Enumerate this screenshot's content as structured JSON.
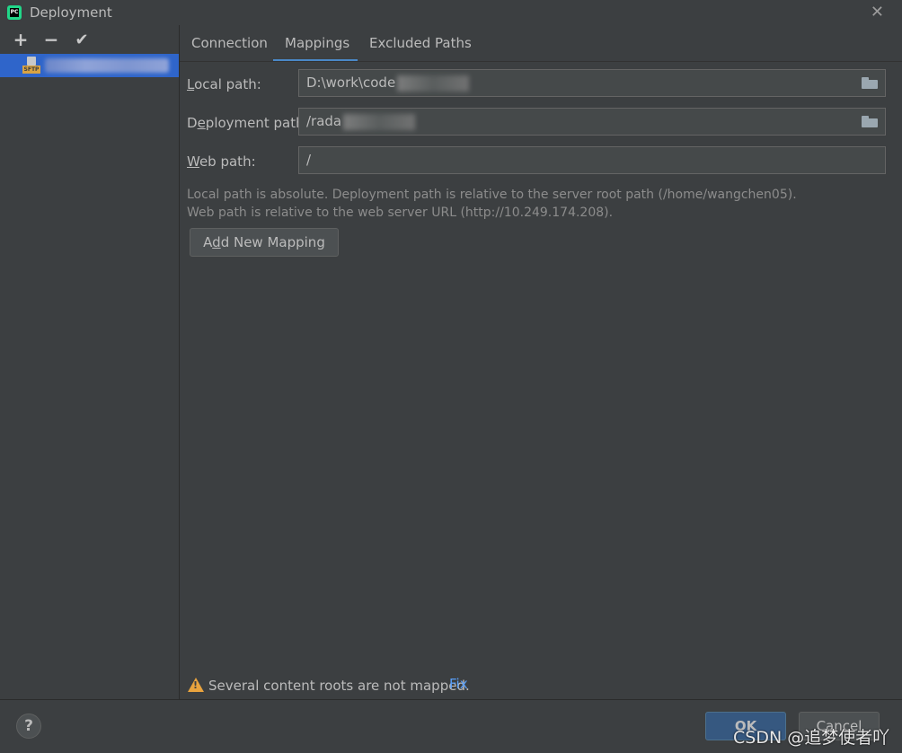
{
  "window": {
    "title": "Deployment",
    "app_icon": "pycharm-icon",
    "app_icon_text": "PC",
    "close_symbol": "✕"
  },
  "left_toolbar": {
    "add_symbol": "+",
    "remove_symbol": "−",
    "check_symbol": "✔"
  },
  "server_list": {
    "items": [
      {
        "type_badge": "SFTP",
        "name": ""
      }
    ]
  },
  "tabs": [
    {
      "label": "Connection"
    },
    {
      "label": "Mappings",
      "active": true
    },
    {
      "label": "Excluded Paths"
    }
  ],
  "mappings": {
    "local_path_label_mn": "L",
    "local_path_label_rest": "ocal path:",
    "local_path_value": "D:\\work\\code",
    "deployment_path_label_pre": "D",
    "deployment_path_label_mn": "e",
    "deployment_path_label_rest": "ployment path:",
    "deployment_path_value": "/rada",
    "web_path_label_mn": "W",
    "web_path_label_rest": "eb path:",
    "web_path_value": "/",
    "help_line_1": "Local path is absolute. Deployment path is relative to the server root path (/home/wangchen05).",
    "help_line_2": "Web path is relative to the web server URL (http://10.249.174.208).",
    "add_mapping_pre": "A",
    "add_mapping_mn": "d",
    "add_mapping_rest": "d New Mapping"
  },
  "status": {
    "warning_icon": "warning-icon",
    "warning_text": "Several content roots are not mapped.",
    "fix_link": "Fix"
  },
  "footer": {
    "help_symbol": "?",
    "ok_label": "OK",
    "cancel_label": "Cancel"
  },
  "watermark": "CSDN @追梦使者吖",
  "colors": {
    "background": "#3c3f41",
    "selection": "#2f65ca",
    "tab_underline": "#4a88c7",
    "link": "#589df6",
    "warning": "#e8a33e",
    "primary_button": "#365880"
  }
}
